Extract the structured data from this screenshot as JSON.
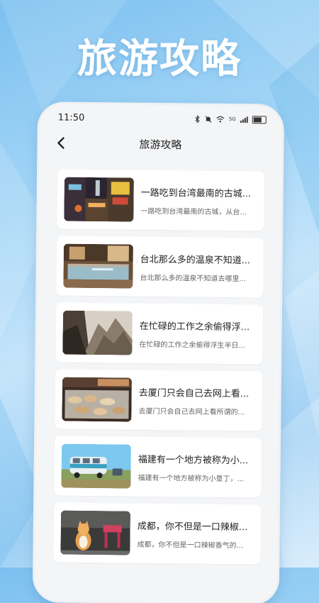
{
  "hero": {
    "title": "旅游攻略"
  },
  "status_bar": {
    "time": "11:50",
    "network": "5G"
  },
  "nav": {
    "title": "旅游攻略",
    "back_icon": "chevron-left-icon"
  },
  "articles": [
    {
      "title": "一路吃到台湾最南的古城...",
      "summary": "一路吃到台湾最南的古城，从台...",
      "image": "night-market-photo"
    },
    {
      "title": "台北那么多的温泉不知道...",
      "summary": "台北那么多的温泉不知道去哪里...",
      "image": "hot-spring-room-photo"
    },
    {
      "title": "在忙碌的工作之余偷得浮...",
      "summary": "在忙碌的工作之余偷得浮生半日...",
      "image": "mountain-photo"
    },
    {
      "title": "去厦门只会自己去网上看...",
      "summary": "去厦门只会自己去网上看所谓的...",
      "image": "street-food-photo"
    },
    {
      "title": "福建有一个地方被称为小...",
      "summary": "福建有一个地方被称为小垦丁，...",
      "image": "camper-van-photo"
    },
    {
      "title": "成都，你不但是一口辣椒...",
      "summary": "成都，你不但是一口辣椒香气的...",
      "image": "cat-photo"
    }
  ]
}
